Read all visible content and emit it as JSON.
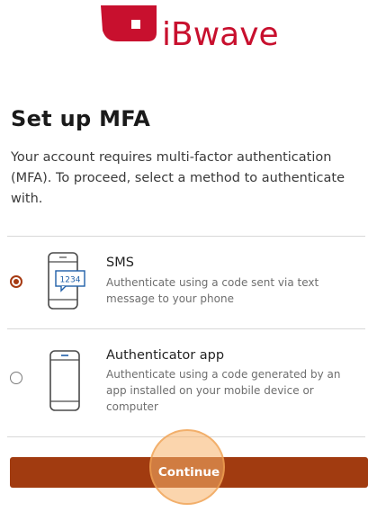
{
  "brand": {
    "name": "iBwave",
    "color": "#c8102e"
  },
  "heading": "Set up MFA",
  "intro": "Your account requires multi-factor authentication (MFA). To proceed, select a method to authenticate with.",
  "options": [
    {
      "title": "SMS",
      "description": "Authenticate using a code sent via text message to your phone",
      "icon": "phone-sms-icon",
      "icon_code": "1234",
      "selected": true
    },
    {
      "title": "Authenticator app",
      "description": "Authenticate using a code generated by an app installed on your mobile device or computer",
      "icon": "phone-app-icon",
      "selected": false
    }
  ],
  "continue_label": "Continue",
  "colors": {
    "accent": "#a13b10",
    "click_highlight": "#f8b269"
  }
}
